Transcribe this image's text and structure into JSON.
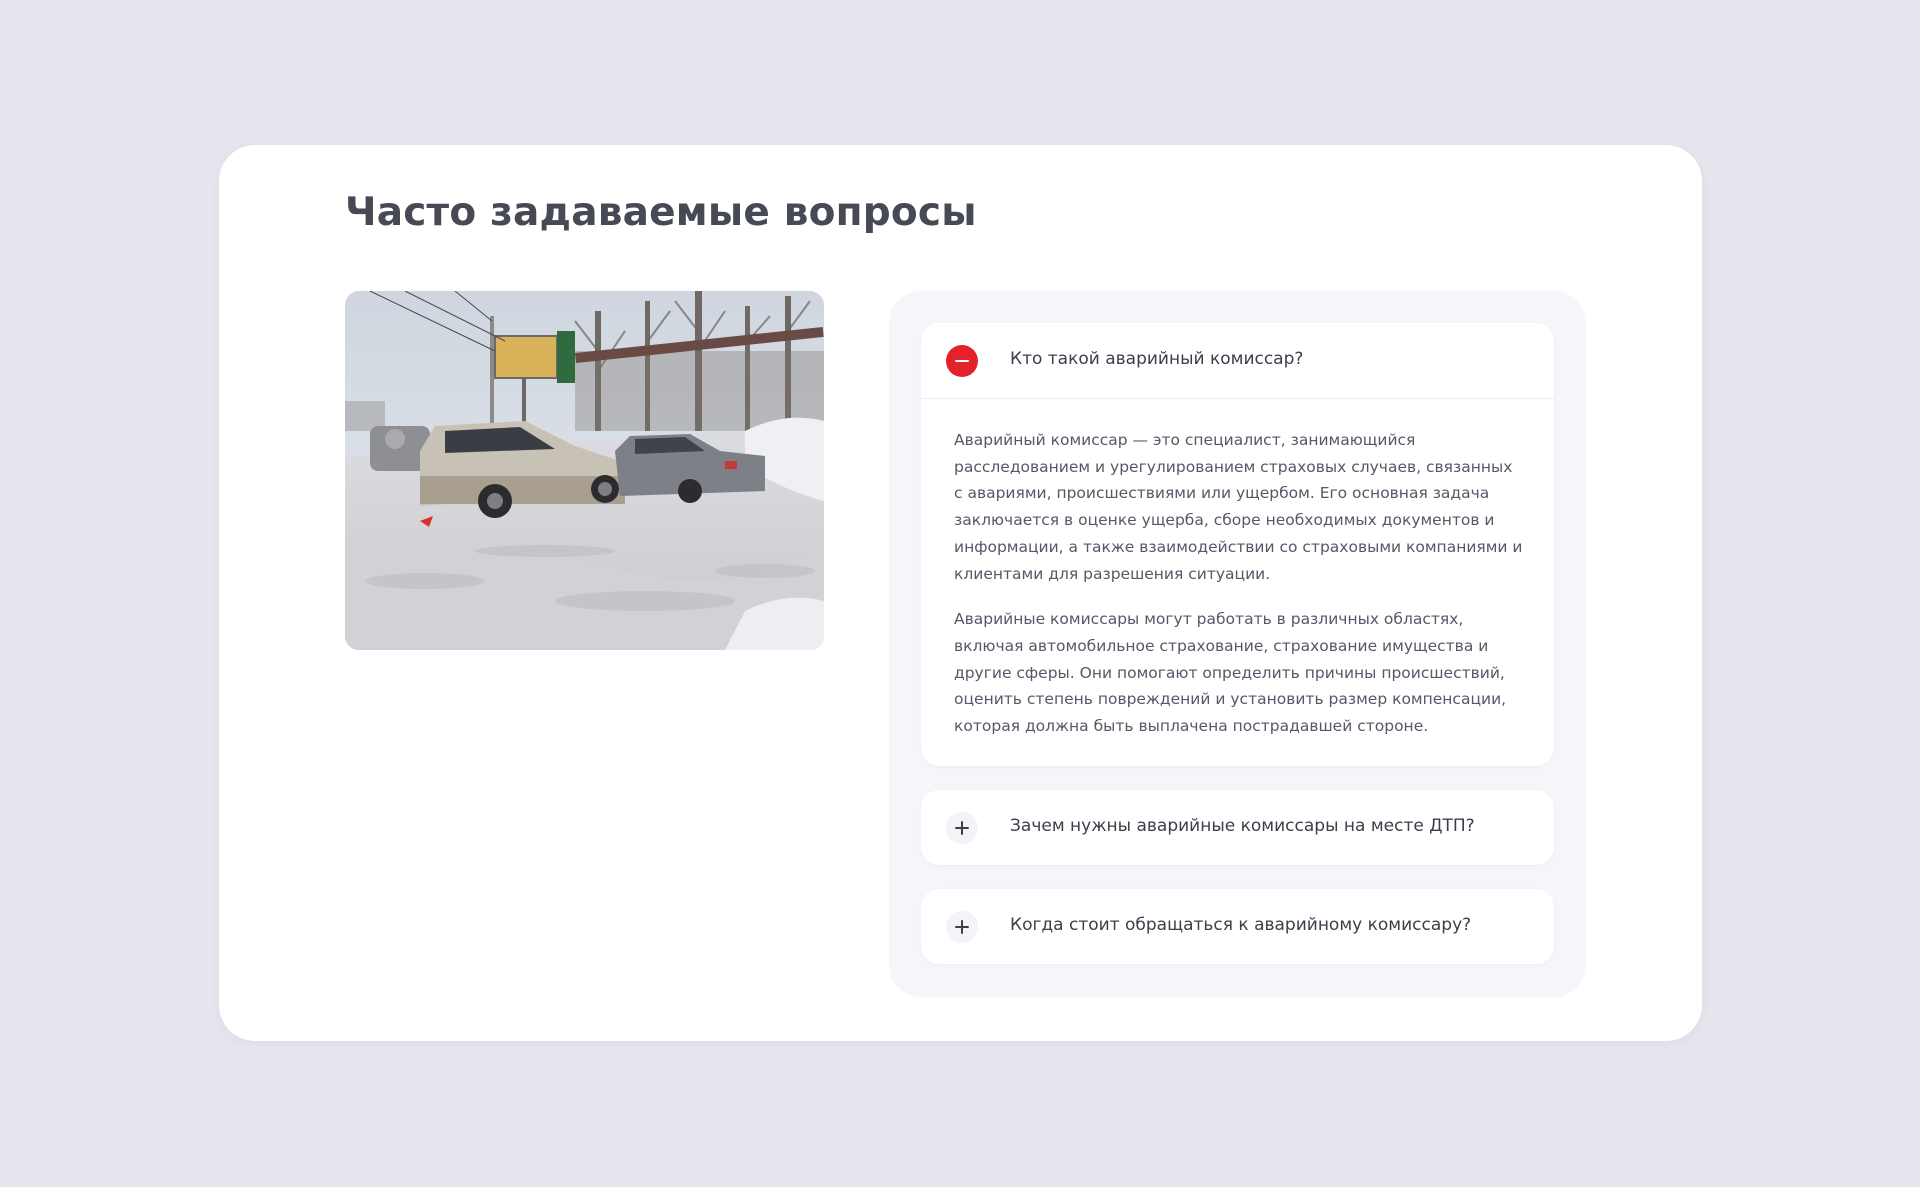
{
  "page": {
    "title": "Часто задаваемые вопросы"
  },
  "photo": {
    "alt": "Фото ДТП"
  },
  "faq": {
    "items": [
      {
        "question": "Кто такой аварийный комиссар?",
        "expanded": true,
        "toggle_icon": "minus-icon",
        "answer": [
          "Аварийный комиссар — это специалист, занимающийся расследованием и урегулированием страховых случаев, связанных с авариями, происшествиями или ущербом. Его основная задача заключается в оценке ущерба, сборе необходимых документов и информации, а также взаимодействии со страховыми компаниями и клиентами для разрешения ситуации.",
          "Аварийные комиссары могут работать в различных областях, включая автомобильное страхование, страхование имущества и другие сферы. Они помогают определить причины происшествий, оценить степень повреждений и установить размер компенсации, которая должна быть выплачена пострадавшей стороне."
        ]
      },
      {
        "question": "Зачем нужны аварийные комиссары на месте ДТП?",
        "expanded": false,
        "toggle_icon": "plus-icon"
      },
      {
        "question": "Когда стоит обращаться к аварийному комиссару?",
        "expanded": false,
        "toggle_icon": "plus-icon"
      }
    ]
  },
  "colors": {
    "page_background": "#e6e5ee",
    "card_background": "#ffffff",
    "panel_background": "#f6f5fa",
    "accent_red": "#e4222b",
    "text_dark": "#3c3f4a"
  }
}
